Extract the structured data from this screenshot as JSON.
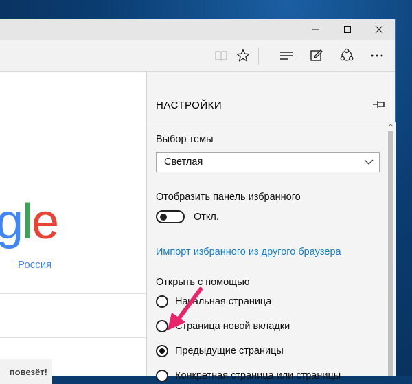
{
  "window": {
    "controls": {
      "minimize_icon": "minimize-icon",
      "maximize_icon": "maximize-icon",
      "close_icon": "close-icon"
    }
  },
  "toolbar": {
    "icons": [
      "reading-view-icon",
      "favorite-star-icon",
      "hub-icon",
      "web-note-icon",
      "share-icon",
      "more-icon"
    ]
  },
  "page": {
    "logo_letters": [
      "g",
      "l",
      "e"
    ],
    "region": "Россия",
    "lucky_label": "повезёт!"
  },
  "settings": {
    "title": "НАСТРОЙКИ",
    "theme_label": "Выбор темы",
    "theme_value": "Светлая",
    "favorites_bar_label": "Отобразить панель избранного",
    "favorites_bar_state": "Откл.",
    "import_link": "Импорт избранного из другого браузера",
    "open_with_label": "Открыть с помощью",
    "open_with_options": [
      {
        "label": "Начальная страница",
        "checked": false
      },
      {
        "label": "Страница новой вкладки",
        "checked": false
      },
      {
        "label": "Предыдущие страницы",
        "checked": true
      },
      {
        "label": "Конкретная страница или страницы",
        "checked": false
      }
    ]
  },
  "colors": {
    "accent_link": "#1a7fc9",
    "annotation_arrow": "#e8246b",
    "logo_blue": "#4285f4",
    "logo_green": "#34a853",
    "logo_red": "#ea4335"
  }
}
